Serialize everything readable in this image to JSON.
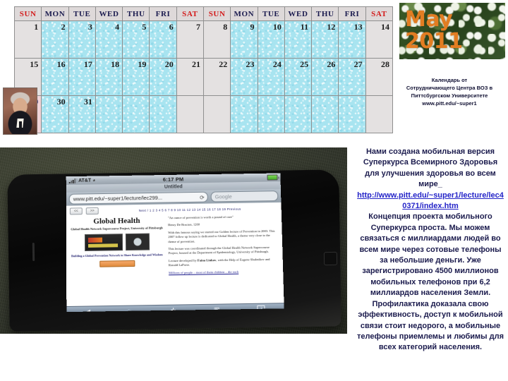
{
  "calendar": {
    "headers": [
      "SUN",
      "MON",
      "TUE",
      "WED",
      "THU",
      "FRI",
      "SAT",
      "SUN",
      "MON",
      "TUE",
      "WED",
      "THU",
      "FRI",
      "SAT"
    ],
    "weekend_indices": [
      0,
      6,
      7,
      13
    ],
    "rows": [
      [
        "1",
        "2",
        "3",
        "4",
        "5",
        "6",
        "7",
        "8",
        "9",
        "10",
        "11",
        "12",
        "13",
        "14"
      ],
      [
        "15",
        "16",
        "17",
        "18",
        "19",
        "20",
        "21",
        "22",
        "23",
        "24",
        "25",
        "26",
        "27",
        "28"
      ],
      [
        "29",
        "30",
        "31",
        "",
        "",
        "",
        "",
        "",
        "",
        "",
        "",
        "",
        "",
        ""
      ]
    ],
    "highlighted_day": "29",
    "colors": {
      "weekend_header_text": "#d31a1a",
      "weekday_header_text": "#1a1a4e",
      "header_bg": "#ded9d9",
      "weekday_cell_bg": "#a8e4f0",
      "weekend_cell_bg": "#e4e1e1",
      "highlight_cell_bg": "#f0d4d8"
    }
  },
  "photo": {
    "month_year": "May\n2011",
    "month": "May",
    "year": "2011",
    "title_color": "#e27d22"
  },
  "credit": {
    "line1": "Календарь от",
    "line2": "Сотрудничающего Центра ВОЗ в",
    "line3": "Питтсбургском Университете",
    "line4": "www.pitt.edu/~super1"
  },
  "body": {
    "para1": "Нами создана мобильная версия Суперкурса Всемирного Здоровья для улучшения здоровья во всем мире_",
    "link": "http://www.pitt.edu/~super1/lecture/lec40371/index.htm",
    "para2": "Концепция проекта мобильного Суперкурса проста. Мы можем связаться с миллиардами людей во всем мире через сотовые телефоны за небольшие деньги. Уже зарегистрировано 4500 миллионов мобильных телефонов при 6,2 миллиардов населения Земли. Профилактика доказала свою эффективность, доступ к мобильной связи стоит недорого, а  мобильные телефоны приемлемы и любимы для всех категорий населения."
  },
  "phone": {
    "status": {
      "carrier": "AT&T",
      "time": "6:17 PM"
    },
    "page_title": "Untitled",
    "url": "www.pitt.edu/~super1/lecture/lec299...",
    "search_placeholder": "Google",
    "nav": {
      "prev": "<<",
      "next": ">>",
      "lecture_list": "Next /  1  2 3 4 5  6 7 8 9  10 11  12 13 14 15 16 17 18 19  Previous"
    },
    "page": {
      "heading": "Global Health",
      "subheading": "Global Health Network Supercourse Project, University of Pittsburgh",
      "caption": "Building a Global Prevention Network to Share Knowledge and Wisdom",
      "quote": "\"An ounce of prevention is worth a pound of cure\"",
      "quote_attr": "Henry De Bracton, 1260",
      "para1": "With this famous saying we started our Golden lecture of Prevention in 2003. This 2007 follow up lecture is dedicated to Global Health, a theme very close to the theme of prevention.",
      "para2": "This lecture was coordinated through the Global Health Network Supercourse Project, housed at the Department of Epidemiology, University of Pittsburgh.",
      "para3_pre": "Lecture developed by ",
      "para3_name": "Faina Linkov",
      "para3_post": ", with the Help of Eugene Shubnikov and Ronald LaPorte.",
      "link_line": "Millions of people – most of them children – die each"
    },
    "toolbar": {
      "back": "◀",
      "forward": "▶",
      "add": "✛",
      "bookmarks": "▥",
      "tabs": "2"
    }
  }
}
